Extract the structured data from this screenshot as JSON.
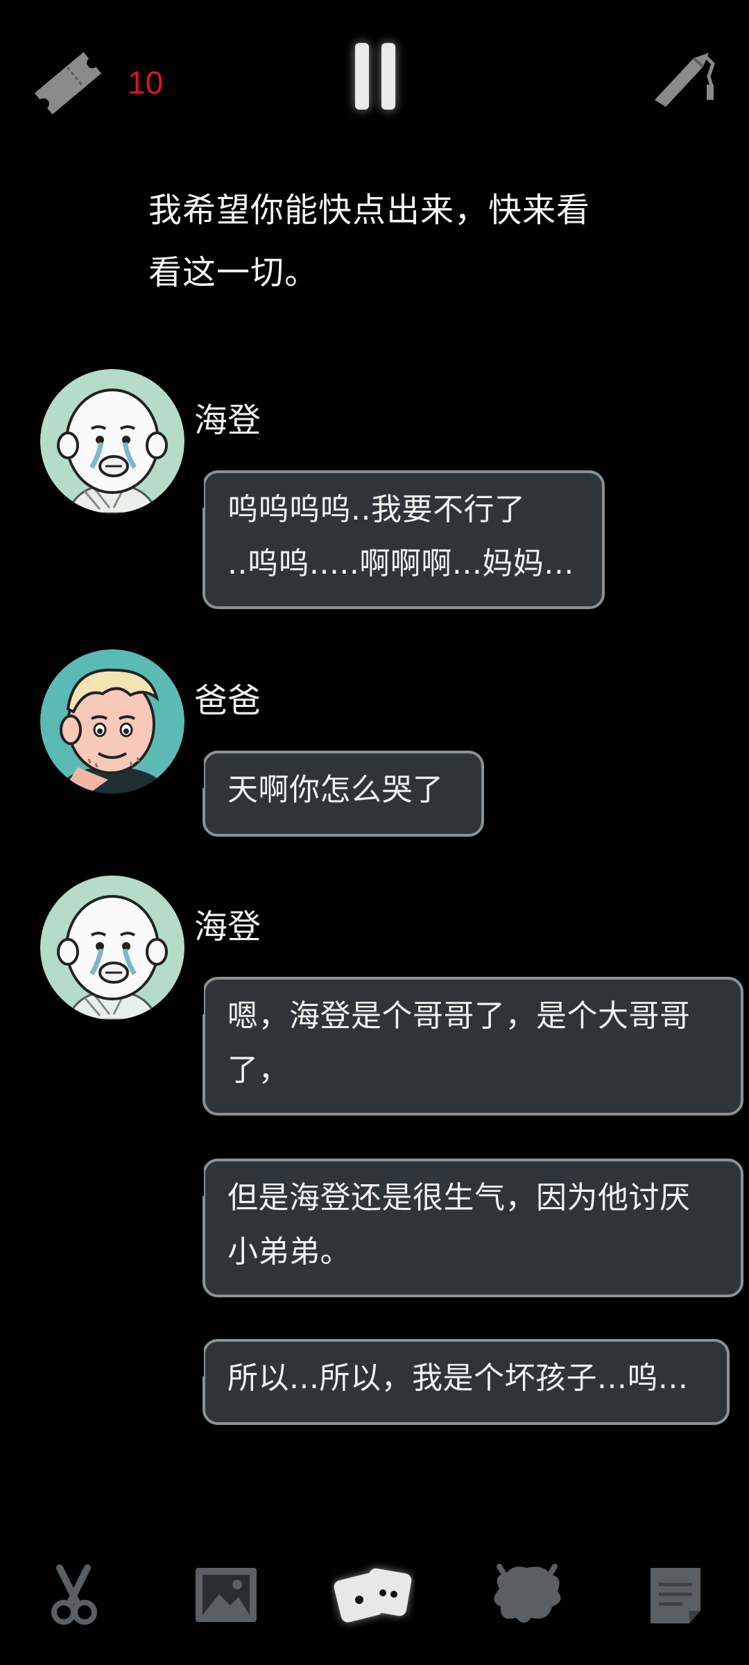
{
  "topbar": {
    "ticket_icon": "ticket-icon",
    "ticket_count": "10",
    "pause_icon": "pause-icon",
    "tool_icon": "tool-icon"
  },
  "narration": {
    "line1": "我希望你能快点出来，快来看",
    "line2": "看这一切。"
  },
  "messages": [
    {
      "speaker": "海登",
      "lines": [
        "呜呜呜呜..我要不行了",
        "..呜呜.....啊啊啊...妈妈..."
      ]
    },
    {
      "speaker": "爸爸",
      "lines": [
        "天啊你怎么哭了"
      ]
    },
    {
      "speaker": "海登",
      "bubbles": [
        {
          "lines": [
            "嗯，海登是个哥哥了，是个大哥哥",
            "了，"
          ]
        },
        {
          "lines": [
            "但是海登还是很生气，因为他讨厌",
            "小弟弟。"
          ]
        },
        {
          "lines": [
            "所以...所以，我是个坏孩子...呜..."
          ]
        }
      ]
    }
  ],
  "bottom_nav": [
    {
      "icon": "scissors-icon"
    },
    {
      "icon": "gallery-icon"
    },
    {
      "icon": "chat-cards-icon",
      "active": true
    },
    {
      "icon": "creature-icon"
    },
    {
      "icon": "document-icon"
    }
  ],
  "colors": {
    "background": "#000000",
    "bubble_fill": "#2d353b",
    "bubble_border": "#8b9296",
    "ticket_count": "#e1141b",
    "avatar_mint": "#b5dcc8",
    "avatar_teal": "#5cbab4"
  }
}
